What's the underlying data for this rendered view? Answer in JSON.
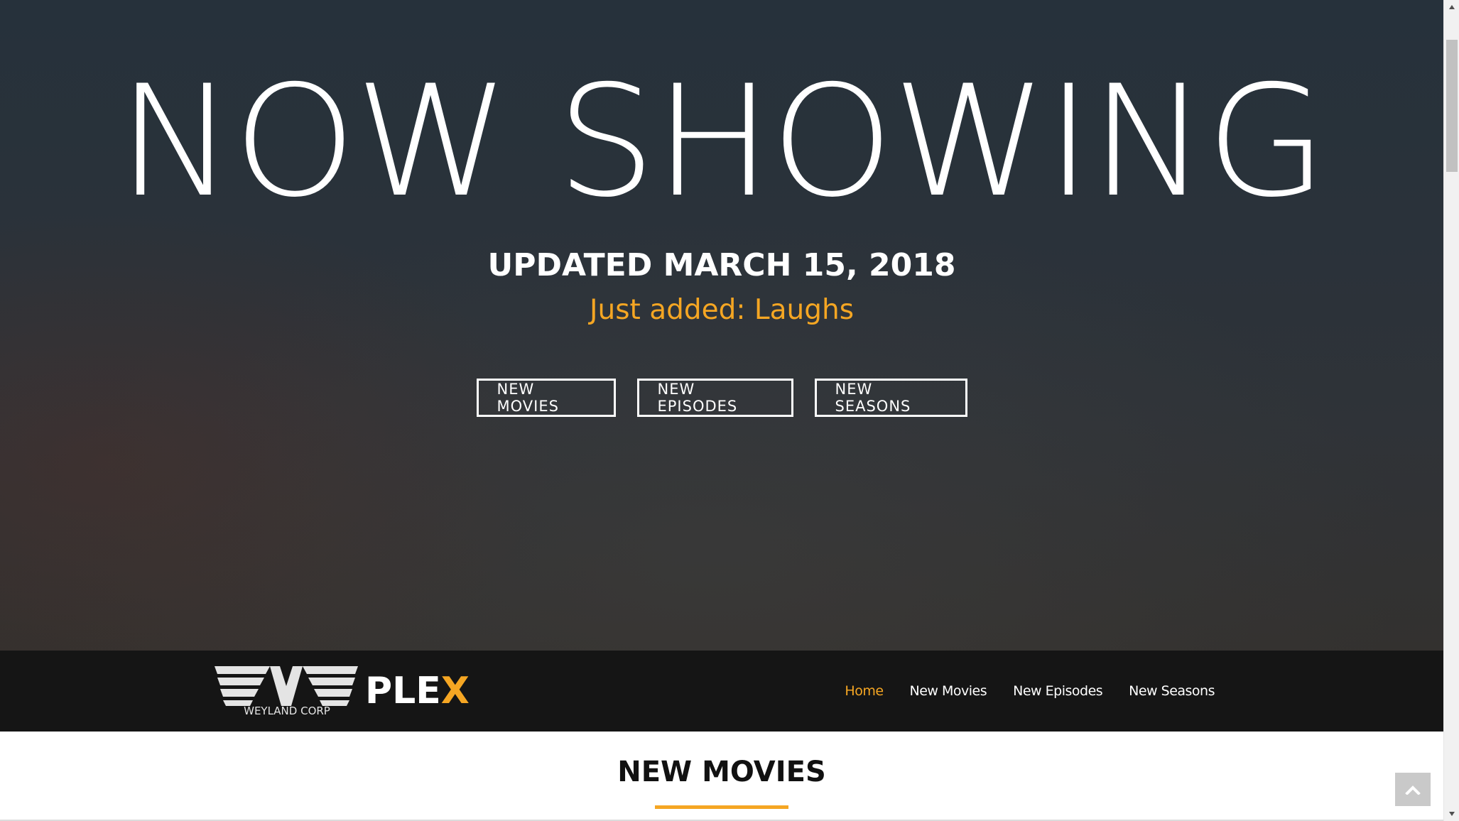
{
  "hero": {
    "title": "NOW SHOWING",
    "updated": "UPDATED MARCH 15, 2018",
    "just_added": "Just added: Laughs",
    "buttons": {
      "new_movies": "NEW MOVIES",
      "new_episodes": "NEW EPISODES",
      "new_seasons": "NEW SEASONS"
    }
  },
  "navbar": {
    "logo_text": "WEYLAND CORP",
    "brand": "PLE",
    "brand_x": "X",
    "links": {
      "home": "Home",
      "new_movies": "New Movies",
      "new_episodes": "New Episodes",
      "new_seasons": "New Seasons"
    },
    "active": "Home"
  },
  "section": {
    "title": "NEW MOVIES"
  },
  "icons": {
    "back_to_top": "chevron-up-icon",
    "scroll_up": "triangle-up-icon",
    "scroll_down": "triangle-down-icon",
    "logo": "weyland-corp-logo-icon"
  },
  "colors": {
    "accent": "#f5a623",
    "hero_bg": "#2a323a",
    "navbar_bg": "#151515",
    "text_light": "#ffffff",
    "section_title": "#111111"
  }
}
